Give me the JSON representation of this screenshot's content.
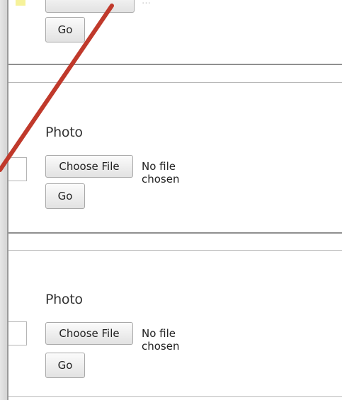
{
  "sections": [
    {
      "go_label": "Go",
      "faded_text": "…"
    },
    {
      "label": "Photo",
      "choose_label": "Choose File",
      "no_file_text": "No file chosen",
      "go_label": "Go"
    },
    {
      "label": "Photo",
      "choose_label": "Choose File",
      "no_file_text": "No file chosen",
      "go_label": "Go"
    }
  ],
  "colors": {
    "annotation": "#c0392b",
    "divider": "#8f8f8f",
    "yellow_mark": "#f6f29a"
  }
}
